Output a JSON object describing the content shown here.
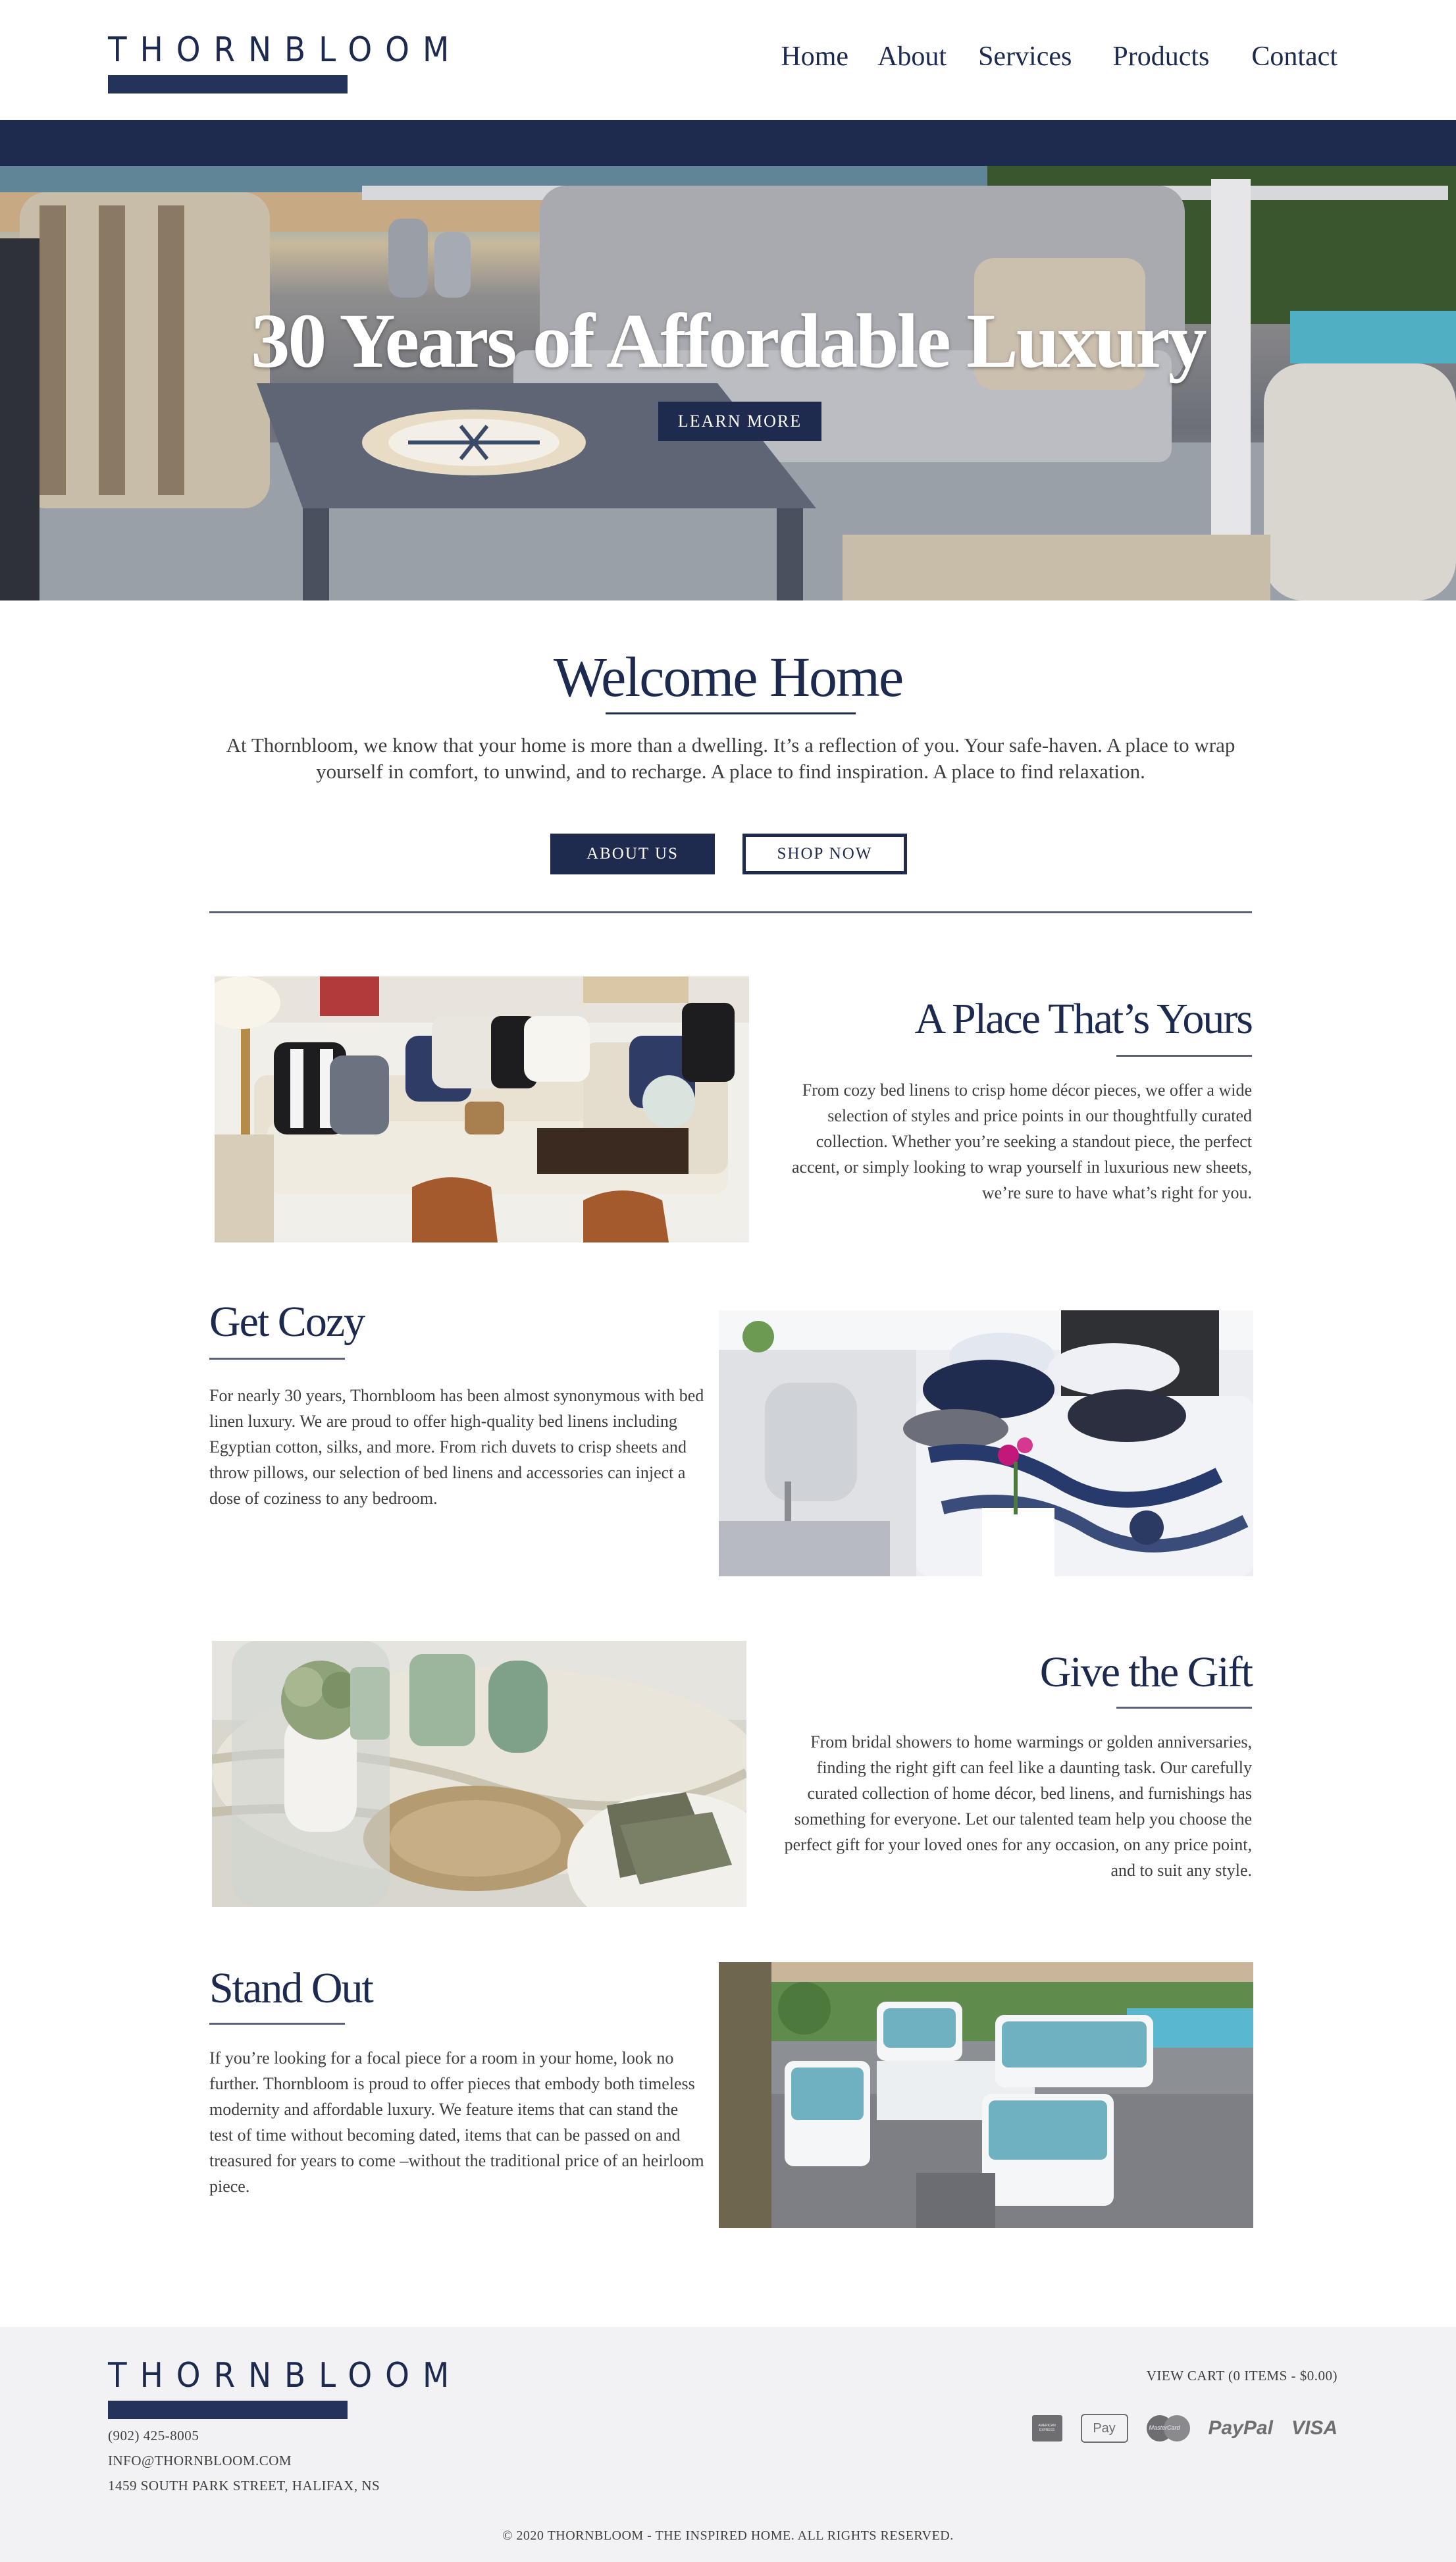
{
  "brand": {
    "name": "THORNBLOOM"
  },
  "nav": {
    "items": [
      "Home",
      "About",
      "Services",
      "Products",
      "Contact"
    ]
  },
  "hero": {
    "title": "30 Years of Affordable Luxury",
    "button": "LEARN MORE"
  },
  "welcome": {
    "title": "Welcome Home",
    "text": "At Thornbloom, we know that your home is more than a dwelling. It’s a reflection of you. Your safe-haven. A place to wrap yourself in comfort, to unwind, and to recharge. A place to find inspiration. A place to find relaxation.",
    "about_button": "ABOUT US",
    "shop_button": "SHOP NOW"
  },
  "sections": [
    {
      "title": "A Place That’s Yours",
      "text": "From cozy bed linens to crisp home décor pieces, we offer a wide selection of styles and price points in our thoughtfully curated collection. Whether you’re seeking a standout piece, the perfect accent, or simply looking to wrap yourself in luxurious new sheets, we’re sure to have what’s right for you."
    },
    {
      "title": "Get Cozy",
      "text": "For nearly 30 years, Thornbloom has been almost synonymous with bed linen luxury. We are proud to offer high-quality bed linens including Egyptian cotton, silks, and more. From rich duvets to crisp sheets and throw pillows, our selection of bed linens and accessories can inject a dose of coziness to any bedroom."
    },
    {
      "title": "Give the Gift",
      "text": "From bridal showers to home warmings or golden anniversaries, finding the right gift can feel like a daunting task. Our carefully curated collection of home décor, bed linens, and furnishings has something for everyone. Let our talented team help you choose the perfect gift for your loved ones for any occasion, on any price point, and to suit any style."
    },
    {
      "title": "Stand Out",
      "text": "If you’re looking for a focal piece for a room in your home, look no further. Thornbloom is proud to offer pieces that embody both timeless modernity and affordable luxury. We feature items that can stand the test of time without becoming dated, items that can be passed on and treasured for years to come –without the traditional price of an heirloom piece."
    }
  ],
  "footer": {
    "phone": "(902) 425-8005",
    "email": "INFO@THORNBLOOM.COM",
    "address": "1459 SOUTH PARK STREET, HALIFAX, NS",
    "cart": "VIEW CART (0 ITEMS - $0.00)",
    "payments": {
      "amex": "AMERICAN EXPRESS",
      "apple": "Pay",
      "mastercard": "MasterCard",
      "paypal": "PayPal",
      "visa": "VISA"
    },
    "copyright": "© 2020 THORNBLOOM - THE INSPIRED HOME. ALL RIGHTS RESERVED."
  },
  "colors": {
    "navy": "#1e2a4e",
    "footer_bg": "#f2f2f4",
    "text": "#3e3e3e"
  }
}
